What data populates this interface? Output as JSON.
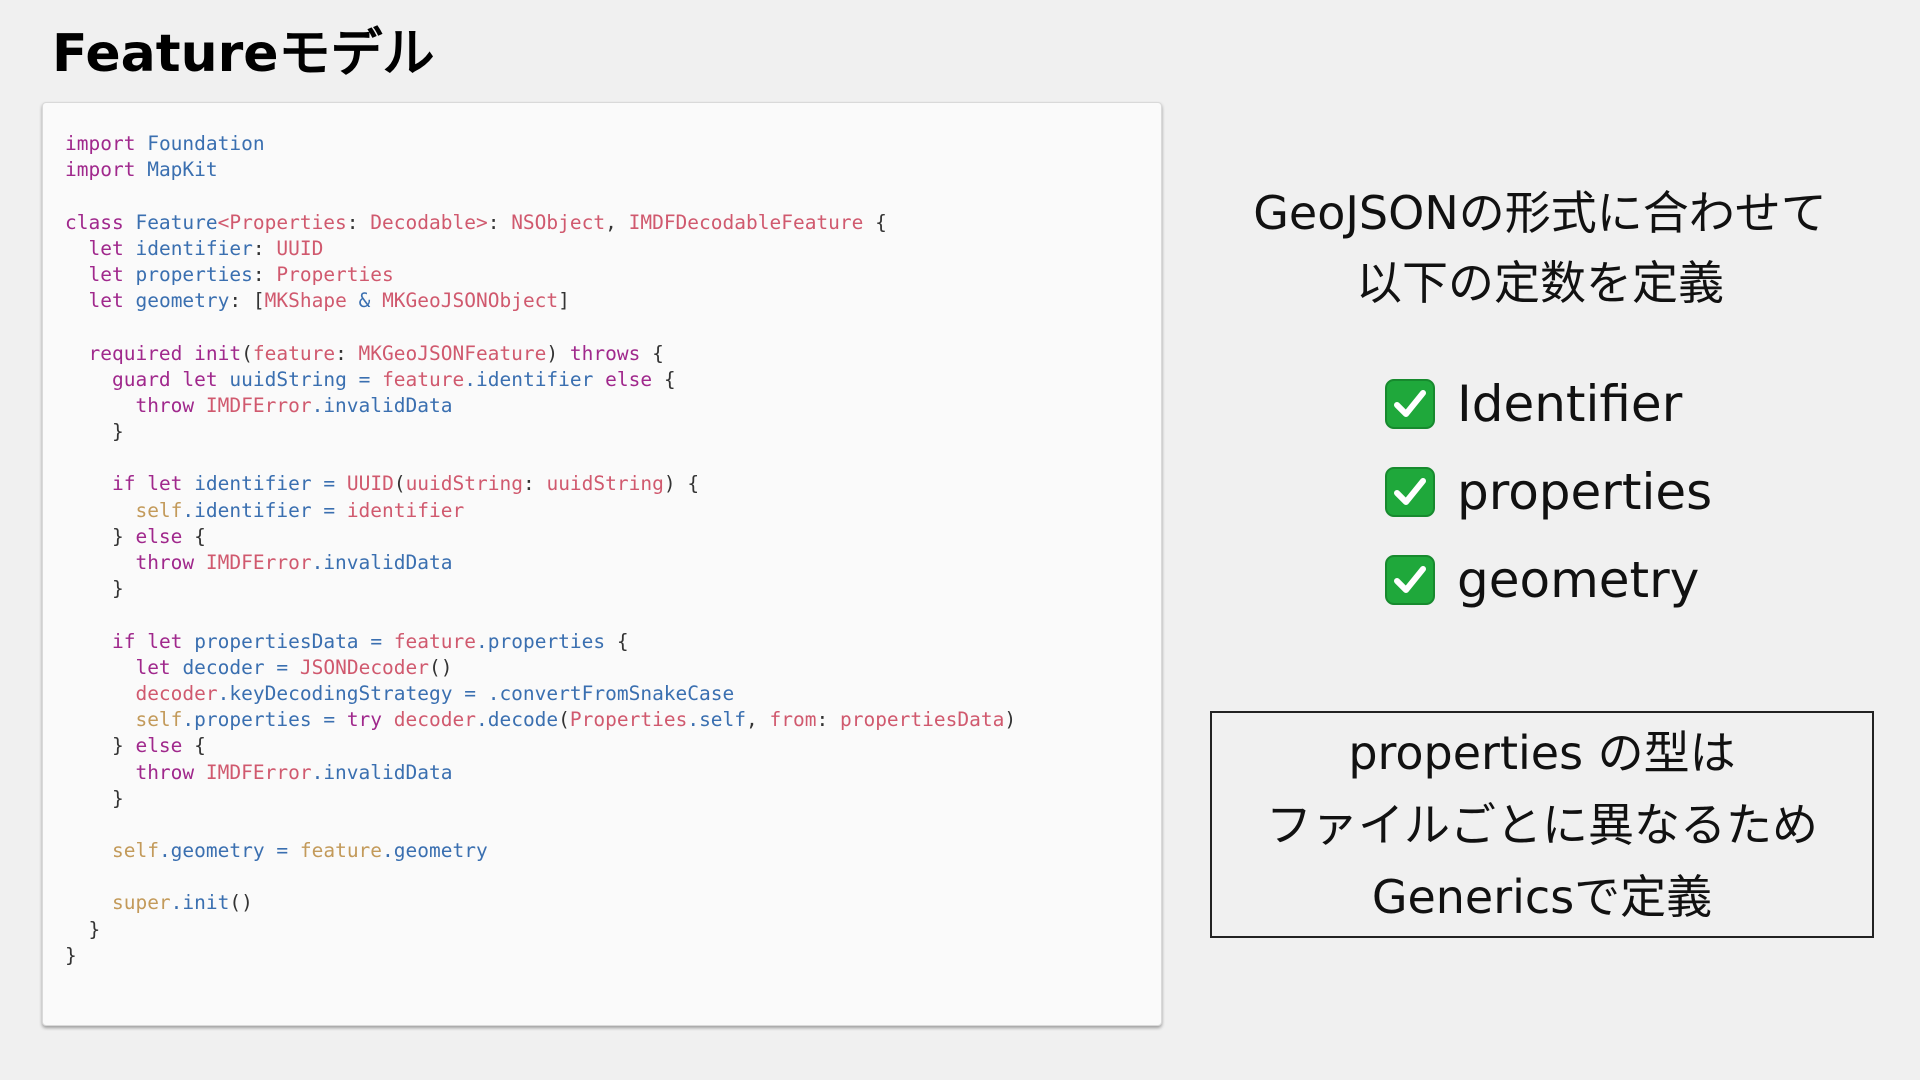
{
  "slide": {
    "title": "Featureモデル"
  },
  "code": {
    "lines": [
      [
        [
          "kw",
          "import"
        ],
        [
          "pl",
          " "
        ],
        [
          "ty",
          "Foundation"
        ]
      ],
      [
        [
          "kw",
          "import"
        ],
        [
          "pl",
          " "
        ],
        [
          "ty",
          "MapKit"
        ]
      ],
      [],
      [
        [
          "kw",
          "class"
        ],
        [
          "pl",
          " "
        ],
        [
          "ty",
          "Feature"
        ],
        [
          "pt",
          "<"
        ],
        [
          "pt",
          "Properties"
        ],
        [
          "pl",
          ": "
        ],
        [
          "pt",
          "Decodable"
        ],
        [
          "pt",
          ">"
        ],
        [
          "pl",
          ": "
        ],
        [
          "pt",
          "NSObject"
        ],
        [
          "pl",
          ", "
        ],
        [
          "pt",
          "IMDFDecodableFeature"
        ],
        [
          "pl",
          " {"
        ]
      ],
      [
        [
          "pl",
          "  "
        ],
        [
          "kw",
          "let"
        ],
        [
          "pl",
          " "
        ],
        [
          "ty",
          "identifier"
        ],
        [
          "pl",
          ": "
        ],
        [
          "pt",
          "UUID"
        ]
      ],
      [
        [
          "pl",
          "  "
        ],
        [
          "kw",
          "let"
        ],
        [
          "pl",
          " "
        ],
        [
          "ty",
          "properties"
        ],
        [
          "pl",
          ": "
        ],
        [
          "pt",
          "Properties"
        ]
      ],
      [
        [
          "pl",
          "  "
        ],
        [
          "kw",
          "let"
        ],
        [
          "pl",
          " "
        ],
        [
          "ty",
          "geometry"
        ],
        [
          "pl",
          ": ["
        ],
        [
          "pt",
          "MKShape"
        ],
        [
          "pl",
          " "
        ],
        [
          "ty",
          "&"
        ],
        [
          "pl",
          " "
        ],
        [
          "pt",
          "MKGeoJSONObject"
        ],
        [
          "pl",
          "]"
        ]
      ],
      [],
      [
        [
          "pl",
          "  "
        ],
        [
          "kw",
          "required"
        ],
        [
          "pl",
          " "
        ],
        [
          "kw",
          "init"
        ],
        [
          "pl",
          "("
        ],
        [
          "pt",
          "feature"
        ],
        [
          "pl",
          ": "
        ],
        [
          "pt",
          "MKGeoJSONFeature"
        ],
        [
          "pl",
          ") "
        ],
        [
          "kw",
          "throws"
        ],
        [
          "pl",
          " {"
        ]
      ],
      [
        [
          "pl",
          "    "
        ],
        [
          "kw",
          "guard"
        ],
        [
          "pl",
          " "
        ],
        [
          "kw",
          "let"
        ],
        [
          "pl",
          " "
        ],
        [
          "ty",
          "uuidString"
        ],
        [
          "pl",
          " "
        ],
        [
          "ty",
          "="
        ],
        [
          "pl",
          " "
        ],
        [
          "pt",
          "feature"
        ],
        [
          "ty",
          ".identifier"
        ],
        [
          "pl",
          " "
        ],
        [
          "kw",
          "else"
        ],
        [
          "pl",
          " {"
        ]
      ],
      [
        [
          "pl",
          "      "
        ],
        [
          "kw",
          "throw"
        ],
        [
          "pl",
          " "
        ],
        [
          "pt",
          "IMDFError"
        ],
        [
          "ty",
          ".invalidData"
        ]
      ],
      [
        [
          "pl",
          "    }"
        ]
      ],
      [],
      [
        [
          "pl",
          "    "
        ],
        [
          "kw",
          "if"
        ],
        [
          "pl",
          " "
        ],
        [
          "kw",
          "let"
        ],
        [
          "pl",
          " "
        ],
        [
          "ty",
          "identifier"
        ],
        [
          "pl",
          " "
        ],
        [
          "ty",
          "="
        ],
        [
          "pl",
          " "
        ],
        [
          "pt",
          "UUID"
        ],
        [
          "pl",
          "("
        ],
        [
          "pt",
          "uuidString"
        ],
        [
          "pl",
          ": "
        ],
        [
          "pt",
          "uuidString"
        ],
        [
          "pl",
          ") {"
        ]
      ],
      [
        [
          "pl",
          "      "
        ],
        [
          "sf",
          "self"
        ],
        [
          "ty",
          ".identifier"
        ],
        [
          "pl",
          " "
        ],
        [
          "ty",
          "="
        ],
        [
          "pl",
          " "
        ],
        [
          "pt",
          "identifier"
        ]
      ],
      [
        [
          "pl",
          "    } "
        ],
        [
          "kw",
          "else"
        ],
        [
          "pl",
          " {"
        ]
      ],
      [
        [
          "pl",
          "      "
        ],
        [
          "kw",
          "throw"
        ],
        [
          "pl",
          " "
        ],
        [
          "pt",
          "IMDFError"
        ],
        [
          "ty",
          ".invalidData"
        ]
      ],
      [
        [
          "pl",
          "    }"
        ]
      ],
      [],
      [
        [
          "pl",
          "    "
        ],
        [
          "kw",
          "if"
        ],
        [
          "pl",
          " "
        ],
        [
          "kw",
          "let"
        ],
        [
          "pl",
          " "
        ],
        [
          "ty",
          "propertiesData"
        ],
        [
          "pl",
          " "
        ],
        [
          "ty",
          "="
        ],
        [
          "pl",
          " "
        ],
        [
          "pt",
          "feature"
        ],
        [
          "ty",
          ".properties"
        ],
        [
          "pl",
          " {"
        ]
      ],
      [
        [
          "pl",
          "      "
        ],
        [
          "kw",
          "let"
        ],
        [
          "pl",
          " "
        ],
        [
          "ty",
          "decoder"
        ],
        [
          "pl",
          " "
        ],
        [
          "ty",
          "="
        ],
        [
          "pl",
          " "
        ],
        [
          "pt",
          "JSONDecoder"
        ],
        [
          "pl",
          "()"
        ]
      ],
      [
        [
          "pl",
          "      "
        ],
        [
          "pt",
          "decoder"
        ],
        [
          "ty",
          ".keyDecodingStrategy"
        ],
        [
          "pl",
          " "
        ],
        [
          "ty",
          "="
        ],
        [
          "pl",
          " "
        ],
        [
          "ty",
          ".convertFromSnakeCase"
        ]
      ],
      [
        [
          "pl",
          "      "
        ],
        [
          "sf",
          "self"
        ],
        [
          "ty",
          ".properties"
        ],
        [
          "pl",
          " "
        ],
        [
          "ty",
          "="
        ],
        [
          "pl",
          " "
        ],
        [
          "kw",
          "try"
        ],
        [
          "pl",
          " "
        ],
        [
          "pt",
          "decoder"
        ],
        [
          "ty",
          ".decode"
        ],
        [
          "pl",
          "("
        ],
        [
          "pt",
          "Properties"
        ],
        [
          "ty",
          ".self"
        ],
        [
          "pl",
          ", "
        ],
        [
          "pt",
          "from"
        ],
        [
          "pl",
          ": "
        ],
        [
          "pt",
          "propertiesData"
        ],
        [
          "pl",
          ")"
        ]
      ],
      [
        [
          "pl",
          "    } "
        ],
        [
          "kw",
          "else"
        ],
        [
          "pl",
          " {"
        ]
      ],
      [
        [
          "pl",
          "      "
        ],
        [
          "kw",
          "throw"
        ],
        [
          "pl",
          " "
        ],
        [
          "pt",
          "IMDFError"
        ],
        [
          "ty",
          ".invalidData"
        ]
      ],
      [
        [
          "pl",
          "    }"
        ]
      ],
      [],
      [
        [
          "pl",
          "    "
        ],
        [
          "sf",
          "self"
        ],
        [
          "ty",
          ".geometry"
        ],
        [
          "pl",
          " "
        ],
        [
          "ty",
          "="
        ],
        [
          "pl",
          " "
        ],
        [
          "sf",
          "feature"
        ],
        [
          "ty",
          ".geometry"
        ]
      ],
      [],
      [
        [
          "pl",
          "    "
        ],
        [
          "sf",
          "super"
        ],
        [
          "ty",
          ".init"
        ],
        [
          "pl",
          "()"
        ]
      ],
      [
        [
          "pl",
          "  }"
        ]
      ],
      [
        [
          "pl",
          "}"
        ]
      ]
    ]
  },
  "intro": {
    "line1": "GeoJSONの形式に合わせて",
    "line2": "以下の定数を定義"
  },
  "checklist": {
    "items": [
      {
        "label": "Identifier",
        "icon": "check-mark-icon"
      },
      {
        "label": "properties",
        "icon": "check-mark-icon"
      },
      {
        "label": "geometry",
        "icon": "check-mark-icon"
      }
    ]
  },
  "note": {
    "line1": "properties の型は",
    "line2": "ファイルごとに異なるため",
    "line3": "Genericsで定義"
  },
  "colors": {
    "keyword": "#a0288c",
    "type": "#3a6fb0",
    "property": "#d0596e",
    "self": "#c39a5a",
    "check": "#1fa83b"
  }
}
